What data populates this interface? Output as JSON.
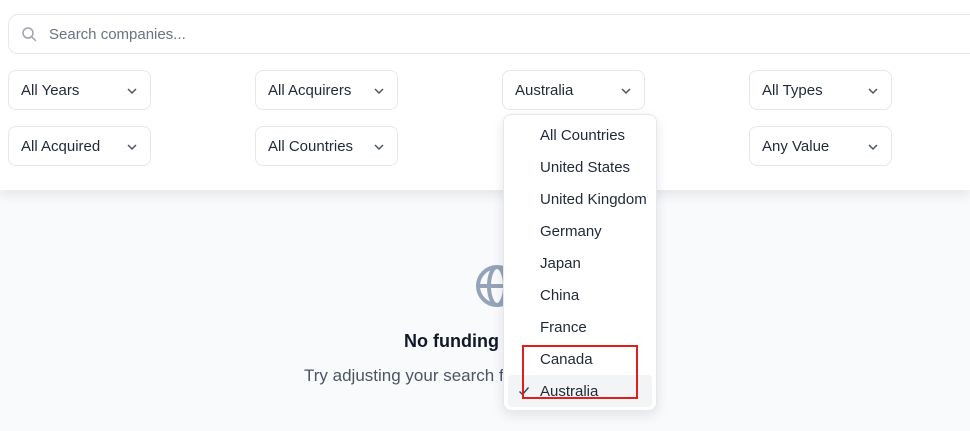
{
  "search": {
    "placeholder": "Search companies...",
    "value": ""
  },
  "filters": {
    "years": "All Years",
    "acquirers": "All Acquirers",
    "country_open": "Australia",
    "types": "All Types",
    "acquired": "All Acquired",
    "countries": "All Countries",
    "value": "Any Value"
  },
  "dropdown": {
    "options": [
      "All Countries",
      "United States",
      "United Kingdom",
      "Germany",
      "Japan",
      "China",
      "France",
      "Canada",
      "Australia"
    ],
    "selected": "Australia"
  },
  "empty_state": {
    "title": "No funding d",
    "message": "Try adjusting your search f                     eals."
  },
  "colors": {
    "accent_highlight": "#e11d1d",
    "border": "#e5e7eb",
    "icon_gray": "#94a3b8"
  }
}
